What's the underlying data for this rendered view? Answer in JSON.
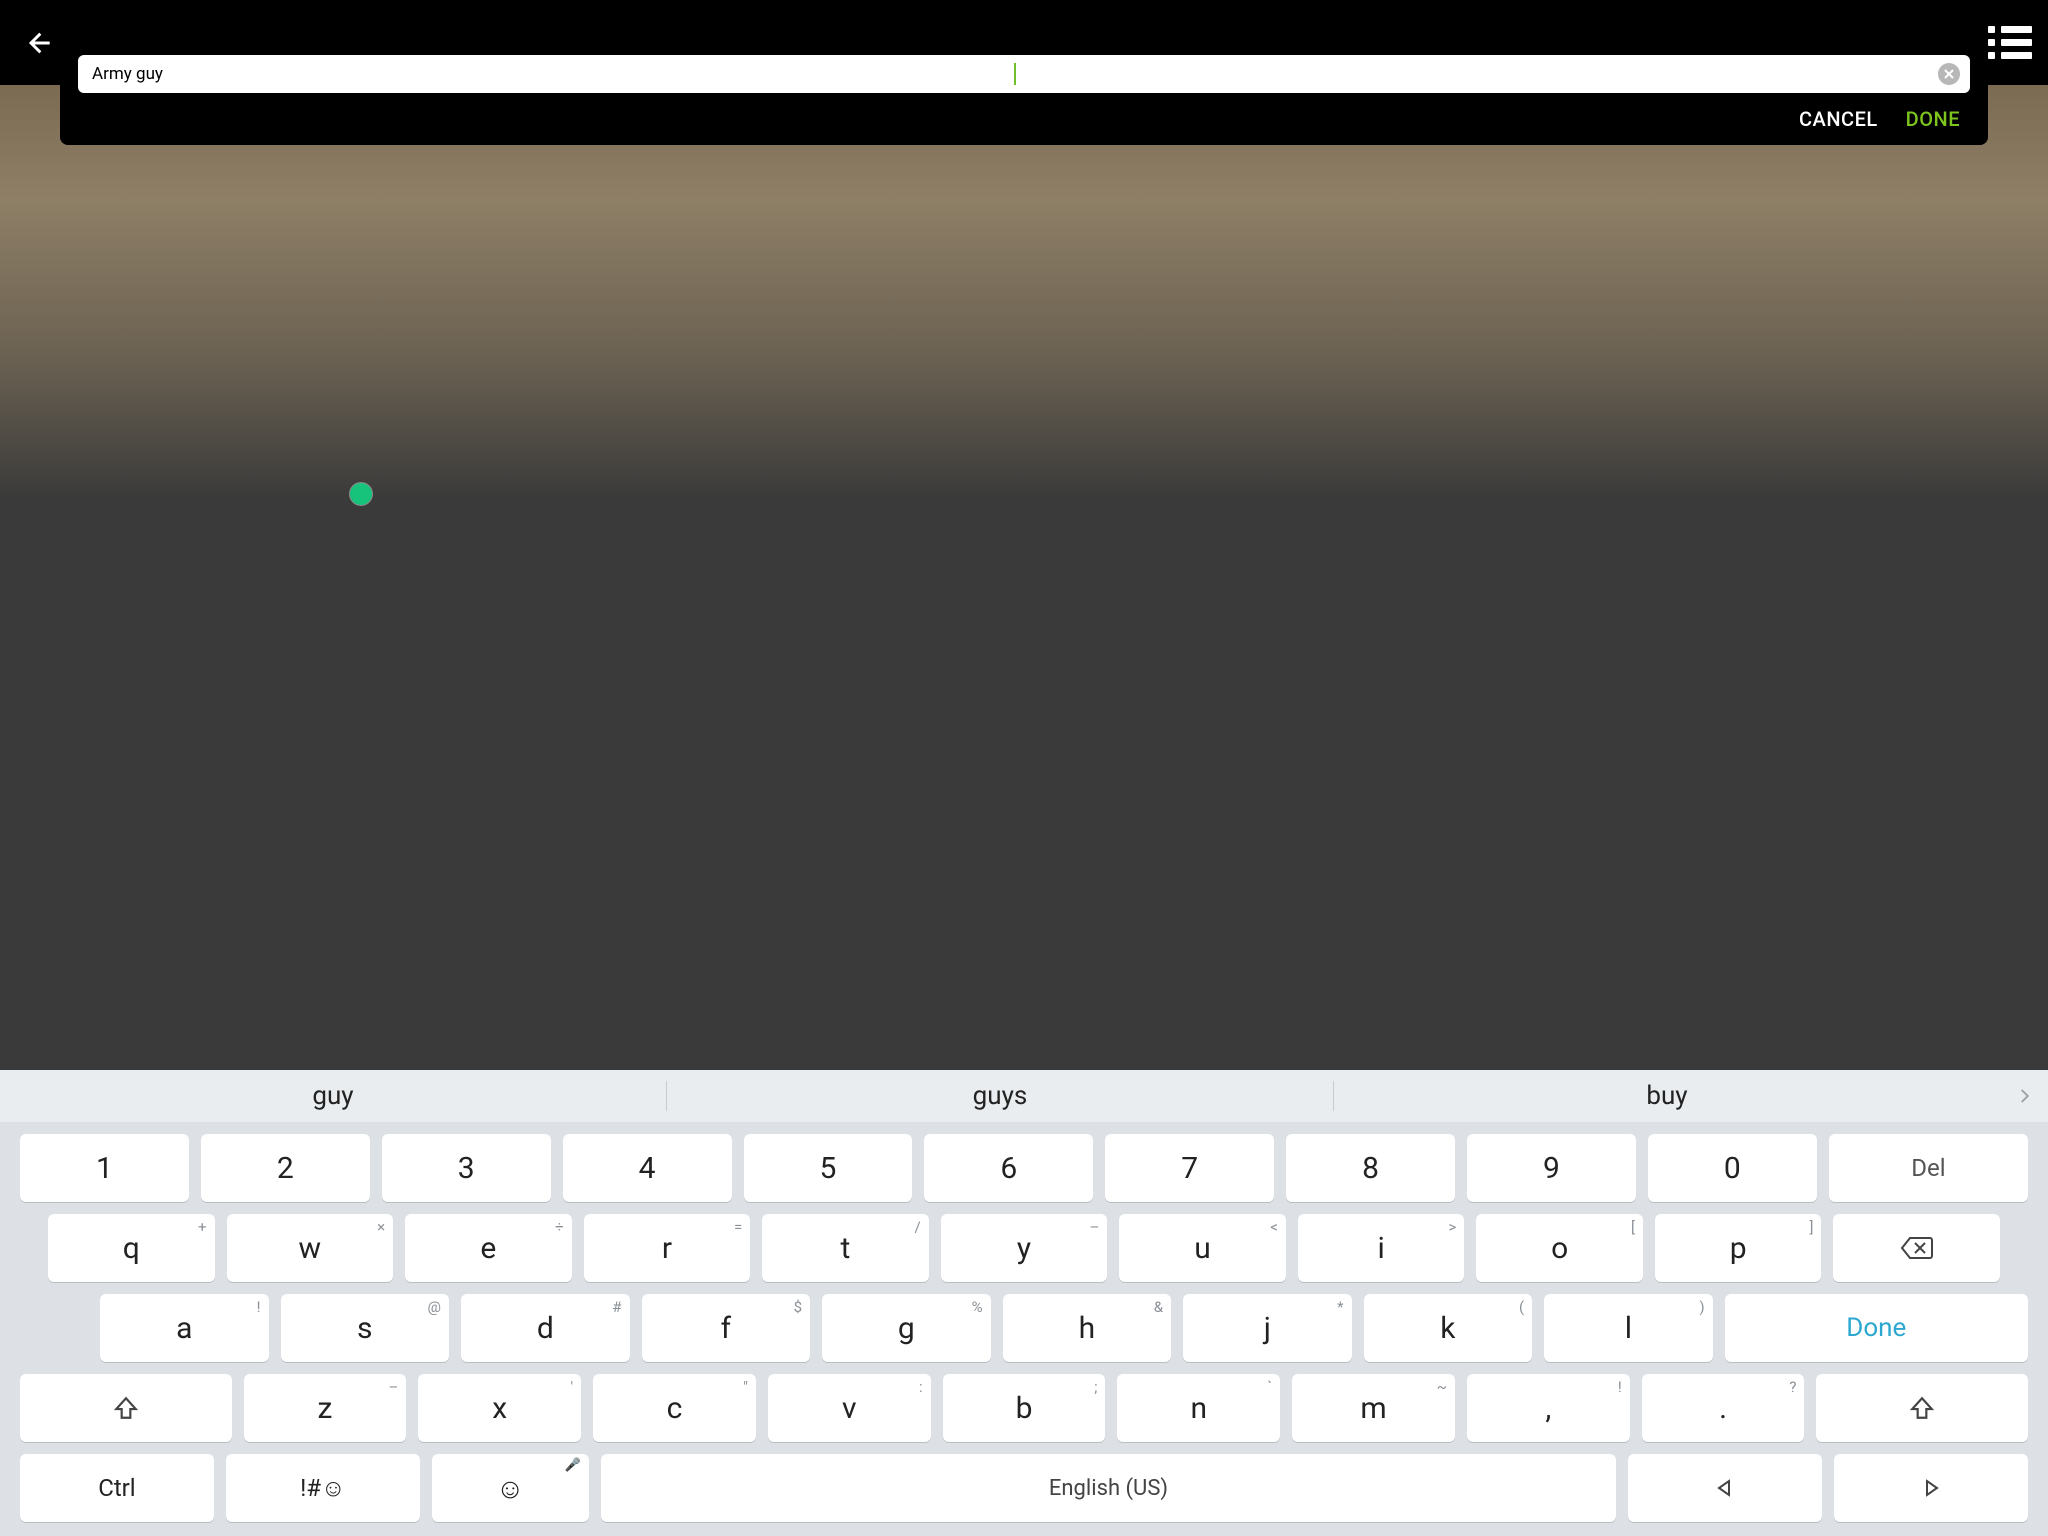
{
  "topbar": {
    "back_icon": "arrow-left",
    "menu_icon": "list-menu"
  },
  "input_panel": {
    "value": "Army guy",
    "clear_icon": "close",
    "cancel_label": "CANCEL",
    "done_label": "DONE"
  },
  "marker": {
    "color": "#17c27b"
  },
  "keyboard": {
    "suggestions": [
      "guy",
      "guys",
      "buy"
    ],
    "more_icon": "chevron-right",
    "rows": {
      "numbers": [
        "1",
        "2",
        "3",
        "4",
        "5",
        "6",
        "7",
        "8",
        "9",
        "0"
      ],
      "del_label": "Del",
      "row_q": [
        {
          "k": "q",
          "hint": "+"
        },
        {
          "k": "w",
          "hint": "×"
        },
        {
          "k": "e",
          "hint": "÷"
        },
        {
          "k": "r",
          "hint": "="
        },
        {
          "k": "t",
          "hint": "/"
        },
        {
          "k": "y",
          "hint": "–"
        },
        {
          "k": "u",
          "hint": "<"
        },
        {
          "k": "i",
          "hint": ">"
        },
        {
          "k": "o",
          "hint": "["
        },
        {
          "k": "p",
          "hint": "]"
        }
      ],
      "backspace_icon": "backspace",
      "row_a": [
        {
          "k": "a",
          "hint": "!"
        },
        {
          "k": "s",
          "hint": "@"
        },
        {
          "k": "d",
          "hint": "#"
        },
        {
          "k": "f",
          "hint": "$"
        },
        {
          "k": "g",
          "hint": "%"
        },
        {
          "k": "h",
          "hint": "&"
        },
        {
          "k": "j",
          "hint": "*"
        },
        {
          "k": "k",
          "hint": "("
        },
        {
          "k": "l",
          "hint": ")"
        }
      ],
      "done_label": "Done",
      "row_z": [
        {
          "k": "z",
          "hint": "–"
        },
        {
          "k": "x",
          "hint": "'"
        },
        {
          "k": "c",
          "hint": "\""
        },
        {
          "k": "v",
          "hint": ":"
        },
        {
          "k": "b",
          "hint": ";"
        },
        {
          "k": "n",
          "hint": "`"
        },
        {
          "k": "m",
          "hint": "~"
        },
        {
          "k": ",",
          "hint": "!"
        },
        {
          "k": ".",
          "hint": "?"
        }
      ],
      "shift_icon": "shift",
      "ctrl_label": "Ctrl",
      "sym_label": "!#☺",
      "emoji_icon": "☺",
      "mic_hint_icon": "mic",
      "space_label": "English (US)",
      "left_icon": "triangle-left",
      "right_icon": "triangle-right"
    }
  }
}
